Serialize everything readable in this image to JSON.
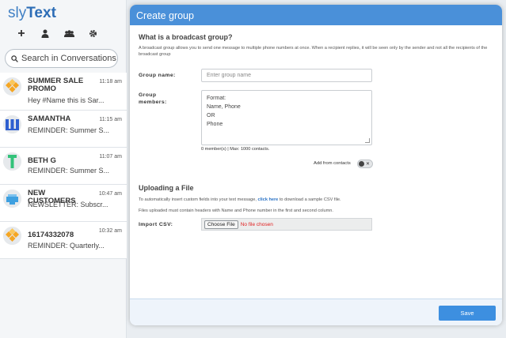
{
  "app": {
    "logo_prefix": "sly",
    "logo_suffix": "Text"
  },
  "toolbar": {
    "icons": [
      "plus-icon",
      "person-icon",
      "group-icon",
      "gear-icon"
    ]
  },
  "search": {
    "placeholder": "Search in Conversations"
  },
  "conversations": [
    {
      "name": "SUMMER SALE PROMO",
      "time": "11:18 am",
      "preview": "Hey #Name this is Sar...",
      "avatar": "orange-tiles"
    },
    {
      "name": "SAMANTHA",
      "time": "11:15 am",
      "preview": "REMINDER: Summer S...",
      "avatar": "blue-stripes"
    },
    {
      "name": "BETH G",
      "time": "11:07 am",
      "preview": "REMINDER: Summer S...",
      "avatar": "green-bar"
    },
    {
      "name": "NEW CUSTOMERS",
      "time": "10:47 am",
      "preview": "NEWSLETTER: Subscr...",
      "avatar": "blue-box"
    },
    {
      "name": "16174332078",
      "time": "10:32 am",
      "preview": "REMINDER: Quarterly...",
      "avatar": "orange-tiles"
    }
  ],
  "modal": {
    "title": "Create group",
    "broadcast_title": "What is a broadcast group?",
    "broadcast_desc": "A broadcast group allows you to send one message to multiple phone numbers at once. When a recipient replies, it will be seen only by the sender and not all the recipients of the broadcast group",
    "group_name_label": "Group name:",
    "group_name_placeholder": "Enter group name",
    "group_members_label": "Group members:",
    "members_placeholder_lines": [
      "Format:",
      "Name, Phone",
      "OR",
      "Phone"
    ],
    "counter": "0 member(s) | Max: 1000 contacts.",
    "add_from_contacts": "Add from contacts",
    "upload_title": "Uploading a File",
    "upload_desc_pre": "To automatically insert custom fields into your text message,",
    "upload_link": "click here",
    "upload_desc_post": "to download a sample CSV file.",
    "upload_note": "Files uploaded must contain headers with Name and Phone number in the first and second column.",
    "import_label": "Import CSV:",
    "choose_file": "Choose File",
    "no_file": "No file chosen",
    "save": "Save"
  },
  "colors": {
    "header": "#4a90d9",
    "save": "#3d8fe0",
    "link": "#2a72c5",
    "error": "#e02020"
  }
}
